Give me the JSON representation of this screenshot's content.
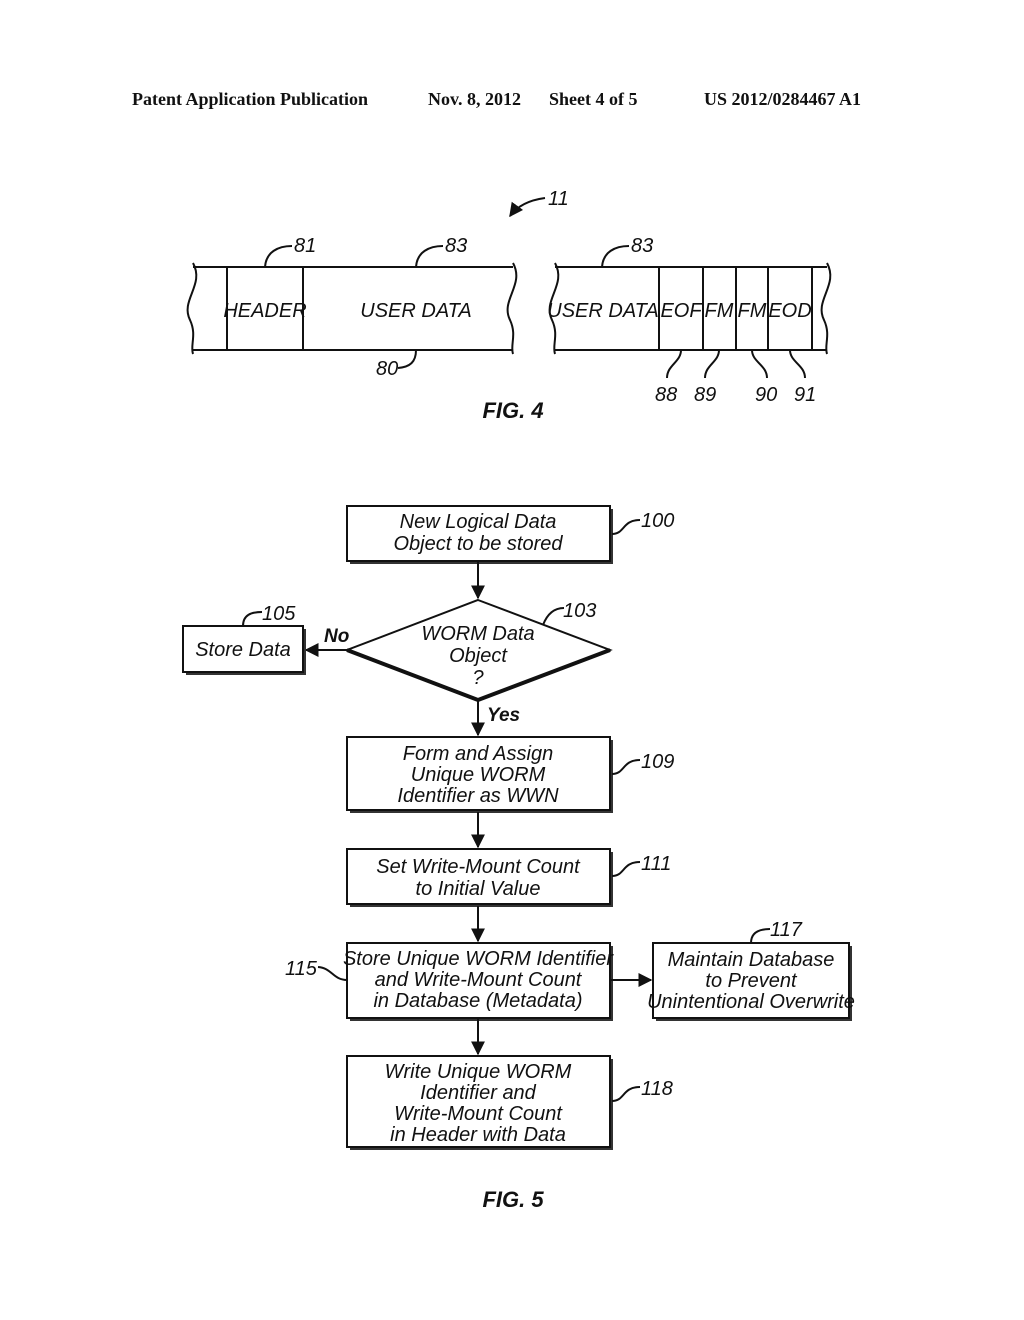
{
  "header": {
    "publication": "Patent Application Publication",
    "date": "Nov. 8, 2012",
    "sheet": "Sheet 4 of 5",
    "number": "US 2012/0284467 A1"
  },
  "fig4": {
    "caption": "FIG. 4",
    "ref_main": "11",
    "left_segment": {
      "cells": [
        "HEADER",
        "USER DATA"
      ],
      "refs": {
        "header": "81",
        "user_data": "83",
        "tape": "80"
      }
    },
    "right_segment": {
      "cells": [
        "USER DATA",
        "EOF",
        "FM",
        "FM",
        "EOD"
      ],
      "refs": {
        "user_data": "83",
        "eof": "88",
        "fm1": "89",
        "fm2": "90",
        "eod": "91"
      }
    }
  },
  "fig5": {
    "caption": "FIG. 5",
    "nodes": [
      {
        "id": "100",
        "type": "process",
        "lines": [
          "New Logical Data",
          "Object to be stored"
        ]
      },
      {
        "id": "103",
        "type": "decision",
        "lines": [
          "WORM Data",
          "Object",
          "?"
        ]
      },
      {
        "id": "105",
        "type": "process",
        "lines": [
          "Store Data"
        ]
      },
      {
        "id": "109",
        "type": "process",
        "lines": [
          "Form and Assign",
          "Unique WORM",
          "Identifier as WWN"
        ]
      },
      {
        "id": "111",
        "type": "process",
        "lines": [
          "Set Write-Mount Count",
          "to Initial Value"
        ]
      },
      {
        "id": "115",
        "type": "process",
        "lines": [
          "Store Unique WORM Identifier",
          "and Write-Mount Count",
          "in Database (Metadata)"
        ]
      },
      {
        "id": "117",
        "type": "process",
        "lines": [
          "Maintain Database",
          "to Prevent",
          "Unintentional Overwrite"
        ]
      },
      {
        "id": "118",
        "type": "process",
        "lines": [
          "Write Unique WORM",
          "Identifier and",
          "Write-Mount Count",
          "in Header with Data"
        ]
      }
    ],
    "edge_labels": {
      "no": "No",
      "yes": "Yes"
    }
  }
}
